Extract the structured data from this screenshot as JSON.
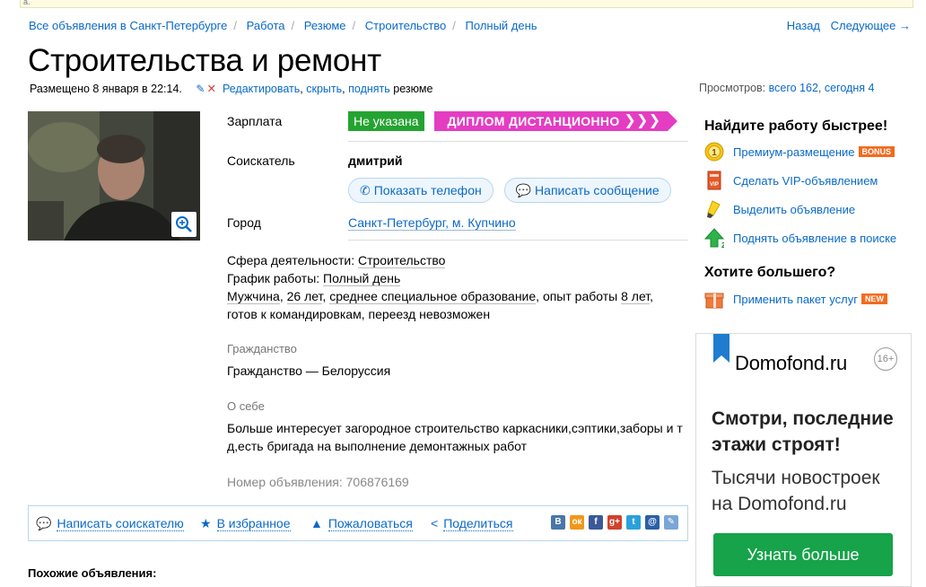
{
  "topbar": {
    "search_glyph": "a."
  },
  "breadcrumbs": [
    "Все объявления в Санкт-Петербурге",
    "Работа",
    "Резюме",
    "Строительство",
    "Полный день"
  ],
  "nav": {
    "back": "Назад",
    "next": "Следующее →"
  },
  "title": "Строительства и ремонт",
  "meta": {
    "posted": "Размещено 8 января в 22:14.",
    "edit": "Редактировать",
    "hide": "скрыть",
    "raise": "поднять",
    "suffix": "резюме",
    "comma1": ",",
    "comma2": ","
  },
  "views": {
    "label": "Просмотров:",
    "total": "всего 162",
    "comma": ",",
    "today": "сегодня 4"
  },
  "details": {
    "salary_label": "Зарплата",
    "salary_value": "Не указана",
    "promo_text": "ДИПЛОМ ДИСТАНЦИОННО",
    "promo_arrows": "❯❯❯",
    "applicant_label": "Соискатель",
    "applicant_name": "дмитрий",
    "show_phone": "Показать телефон",
    "write_message": "Написать сообщение",
    "city_label": "Город",
    "city_value": "Санкт-Петербург, м. Купчино"
  },
  "description": {
    "field_label": "Сфера деятельности:",
    "field_value": "Строительство",
    "schedule_label": "График работы:",
    "schedule_value": "Полный день",
    "gender": "Мужчина",
    "age": "26 лет",
    "education": "среднее специальное образование",
    "exp_label": "опыт работы",
    "exp_value": "8 лет",
    "sep": ", ",
    "trips": "готов к командировкам, переезд невозможен"
  },
  "citizenship": {
    "heading": "Гражданство",
    "text": "Гражданство — Белоруссия"
  },
  "about": {
    "heading": "О себе",
    "line1": "Больше интересует загородное строительство каркасники,сэптики,заборы и т",
    "line2": "д,есть бригада на выполнение демонтажных работ"
  },
  "ad_number": "Номер объявления: 706876169",
  "actions": {
    "write": "Написать соискателю",
    "favorite": "В избранное",
    "complain": "Пожаловаться",
    "share": "Поделиться"
  },
  "social": [
    {
      "name": "vk",
      "glyph": "В",
      "color": "#4a76a8"
    },
    {
      "name": "odnoklassniki",
      "glyph": "ок",
      "color": "#f2961a"
    },
    {
      "name": "facebook",
      "glyph": "f",
      "color": "#3b5998"
    },
    {
      "name": "google-plus",
      "glyph": "g+",
      "color": "#d0422a"
    },
    {
      "name": "twitter",
      "glyph": "t",
      "color": "#2ba1dc"
    },
    {
      "name": "mail-ru",
      "glyph": "@",
      "color": "#2a5fa8"
    },
    {
      "name": "livejournal",
      "glyph": "✎",
      "color": "#7aa6d6"
    }
  ],
  "sidebar": {
    "heading1": "Найдите работу быстрее!",
    "items": [
      {
        "label": "Премиум-размещение",
        "tag": "BONUS",
        "tag_color": "#f26b1f"
      },
      {
        "label": "Сделать VIP-объявлением"
      },
      {
        "label": "Выделить объявление"
      },
      {
        "label": "Поднять объявление в поиске"
      }
    ],
    "heading2": "Хотите большего?",
    "package": {
      "label": "Применить пакет услуг",
      "tag": "NEW",
      "tag_color": "#f26b1f"
    }
  },
  "banner": {
    "logo": "Domofond.ru",
    "age": "16+",
    "headline1": "Смотри, последние",
    "headline2": "этажи строят!",
    "text1": "Тысячи новостроек",
    "text2": "на Domofond.ru",
    "button": "Узнать больше"
  },
  "similar": "Похожие объявления:",
  "colors": {
    "link": "#0a6ac8",
    "green": "#25a332",
    "promo": "#e43dc2",
    "banner_button": "#16a34a"
  }
}
